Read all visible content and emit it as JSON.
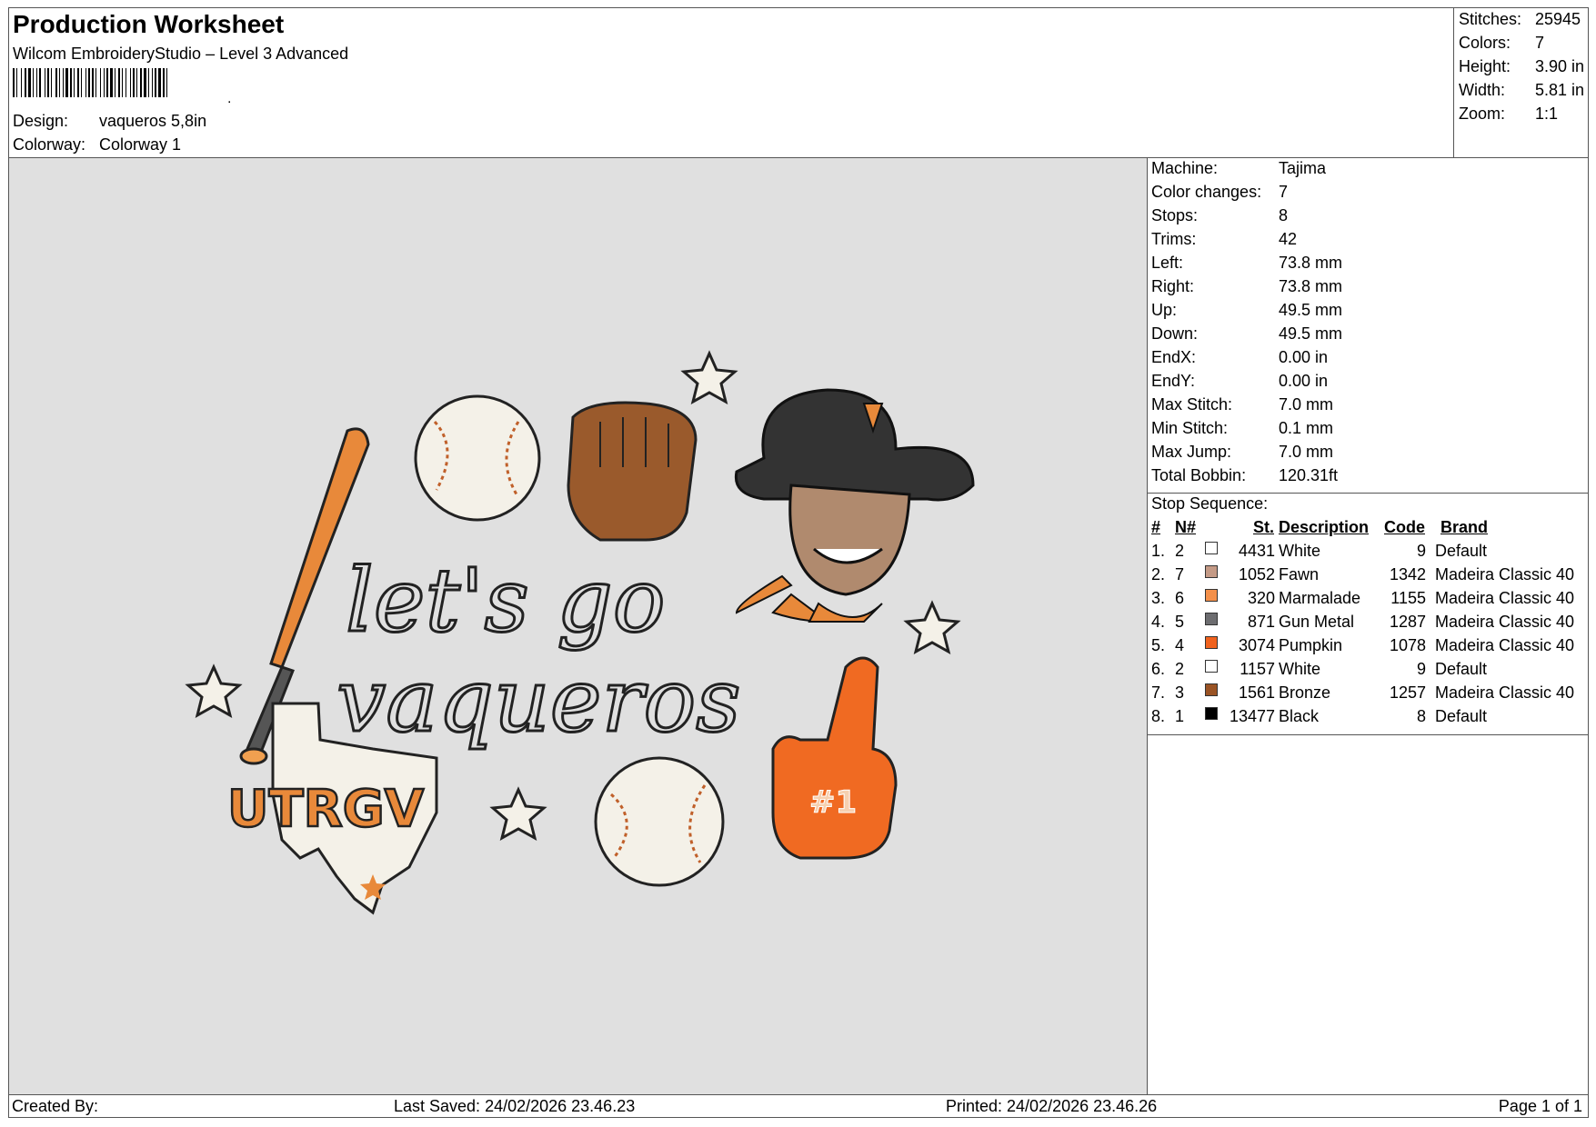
{
  "header": {
    "title": "Production Worksheet",
    "software": "Wilcom EmbroideryStudio – Level 3 Advanced",
    "design_label": "Design:",
    "design_value": "vaqueros 5,8in",
    "colorway_label": "Colorway:",
    "colorway_value": "Colorway 1"
  },
  "stats": [
    {
      "label": "Stitches:",
      "value": "25945"
    },
    {
      "label": "Colors:",
      "value": "7"
    },
    {
      "label": "Height:",
      "value": "3.90 in"
    },
    {
      "label": "Width:",
      "value": "5.81 in"
    },
    {
      "label": "Zoom:",
      "value": "1:1"
    }
  ],
  "machine": [
    {
      "label": "Machine:",
      "value": "Tajima"
    },
    {
      "label": "Color changes:",
      "value": "7"
    },
    {
      "label": "Stops:",
      "value": "8"
    },
    {
      "label": "Trims:",
      "value": "42"
    },
    {
      "label": "Left:",
      "value": "73.8 mm"
    },
    {
      "label": "Right:",
      "value": "73.8 mm"
    },
    {
      "label": "Up:",
      "value": "49.5 mm"
    },
    {
      "label": "Down:",
      "value": "49.5 mm"
    },
    {
      "label": "EndX:",
      "value": "0.00 in"
    },
    {
      "label": "EndY:",
      "value": "0.00 in"
    },
    {
      "label": "Max Stitch:",
      "value": "7.0 mm"
    },
    {
      "label": "Min Stitch:",
      "value": "0.1 mm"
    },
    {
      "label": "Max Jump:",
      "value": "7.0 mm"
    },
    {
      "label": "Total Bobbin:",
      "value": "120.31ft"
    }
  ],
  "stop_sequence": {
    "title": "Stop Sequence:",
    "headers": {
      "num": "#",
      "needle": "N#",
      "stitches": "St.",
      "description": "Description",
      "code": "Code",
      "brand": "Brand"
    },
    "rows": [
      {
        "num": "1.",
        "needle": "2",
        "color": "#ffffff",
        "stitches": "4431",
        "description": "White",
        "code": "9",
        "brand": "Default"
      },
      {
        "num": "2.",
        "needle": "7",
        "color": "#c49a86",
        "stitches": "1052",
        "description": "Fawn",
        "code": "1342",
        "brand": "Madeira Classic 40"
      },
      {
        "num": "3.",
        "needle": "6",
        "color": "#f4904a",
        "stitches": "320",
        "description": "Marmalade",
        "code": "1155",
        "brand": "Madeira Classic 40"
      },
      {
        "num": "4.",
        "needle": "5",
        "color": "#6d6d70",
        "stitches": "871",
        "description": "Gun Metal",
        "code": "1287",
        "brand": "Madeira Classic 40"
      },
      {
        "num": "5.",
        "needle": "4",
        "color": "#f0621e",
        "stitches": "3074",
        "description": "Pumpkin",
        "code": "1078",
        "brand": "Madeira Classic 40"
      },
      {
        "num": "6.",
        "needle": "2",
        "color": "#ffffff",
        "stitches": "1157",
        "description": "White",
        "code": "9",
        "brand": "Default"
      },
      {
        "num": "7.",
        "needle": "3",
        "color": "#9a5324",
        "stitches": "1561",
        "description": "Bronze",
        "code": "1257",
        "brand": "Madeira Classic 40"
      },
      {
        "num": "8.",
        "needle": "1",
        "color": "#000000",
        "stitches": "13477",
        "description": "Black",
        "code": "8",
        "brand": "Default"
      }
    ]
  },
  "artwork": {
    "line1": "let's go",
    "line2": "vaqueros",
    "badge": "UTRGV",
    "finger": "#1",
    "hat_letter": "V"
  },
  "footer": {
    "created_by": "Created By:",
    "last_saved": "Last Saved: 24/02/2026 23.46.23",
    "printed": "Printed: 24/02/2026 23.46.26",
    "page": "Page 1 of 1"
  }
}
